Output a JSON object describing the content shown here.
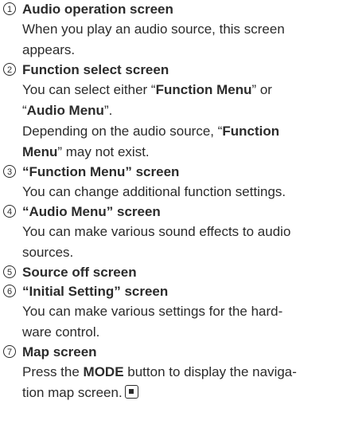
{
  "items": [
    {
      "num": "1",
      "title": "Audio operation screen",
      "lines": [
        "When you play an audio source, this screen",
        "appears."
      ]
    },
    {
      "num": "2",
      "title": "Function select screen",
      "l1a": "You can select either “",
      "l1b": "Function Menu",
      "l1c": "” or",
      "l2a": "“",
      "l2b": "Audio Menu",
      "l2c": "”.",
      "l3a": "Depending on the audio source, “",
      "l3b": "Function",
      "l4a": "Menu",
      "l4b": "” may not exist."
    },
    {
      "num": "3",
      "title": "“Function Menu” screen",
      "lines": [
        "You can change additional function settings."
      ]
    },
    {
      "num": "4",
      "title": "“Audio Menu” screen",
      "lines": [
        "You can make various sound effects to audio",
        "sources."
      ]
    },
    {
      "num": "5",
      "title": "Source off screen"
    },
    {
      "num": "6",
      "title": "“Initial Setting” screen",
      "lines": [
        "You can make various settings for the hard-",
        "ware control."
      ]
    },
    {
      "num": "7",
      "title": "Map screen",
      "l1a": "Press the ",
      "l1b": "MODE",
      "l1c": " button to display the naviga-",
      "l2a": "tion map screen."
    }
  ],
  "end_icon": "end-of-section-icon"
}
